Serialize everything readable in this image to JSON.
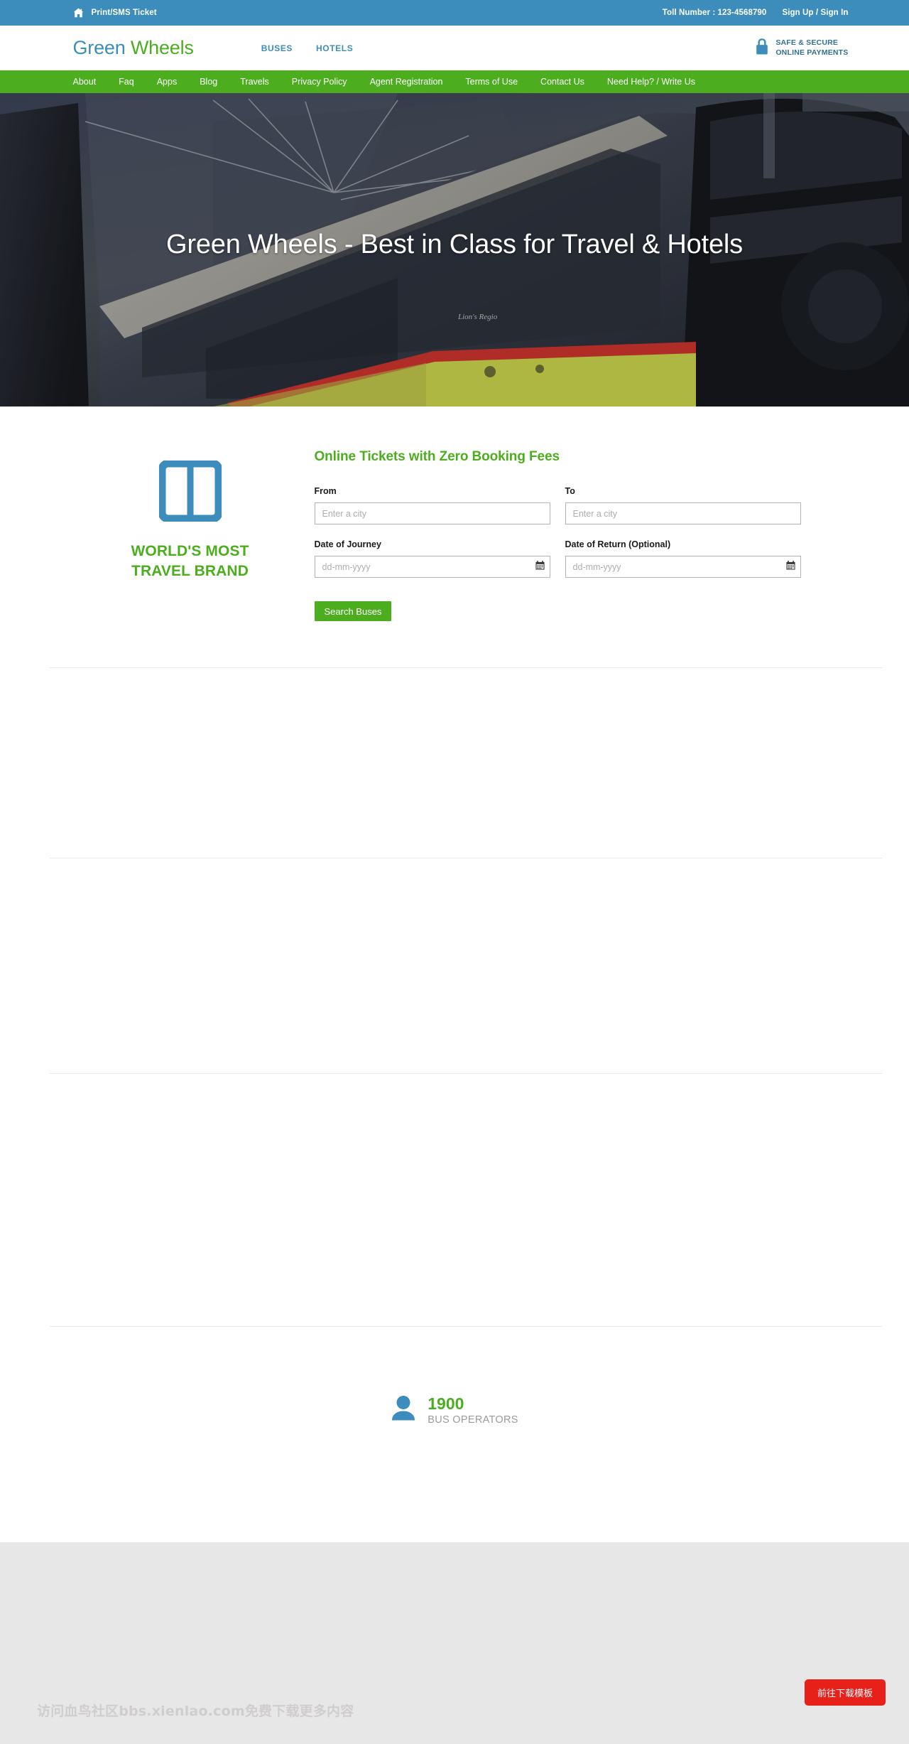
{
  "topbar": {
    "home_icon": "home-icon",
    "print_ticket": "Print/SMS Ticket",
    "toll": "Toll Number : 123-4568790",
    "auth": "Sign Up / Sign In"
  },
  "header": {
    "brand_part1": "Green ",
    "brand_part2": "Wheels",
    "links": [
      {
        "label": "BUSES"
      },
      {
        "label": "HOTELS"
      }
    ],
    "secure_icon": "lock-icon",
    "secure_line1": "SAFE & SECURE",
    "secure_line2": "ONLINE PAYMENTS"
  },
  "nav": {
    "items": [
      {
        "label": "About"
      },
      {
        "label": "Faq"
      },
      {
        "label": "Apps"
      },
      {
        "label": "Blog"
      },
      {
        "label": "Travels"
      },
      {
        "label": "Privacy Policy"
      },
      {
        "label": "Agent Registration"
      },
      {
        "label": "Terms of Use"
      },
      {
        "label": "Contact Us"
      },
      {
        "label": "Need Help?  / Write Us"
      }
    ]
  },
  "hero": {
    "title": "Green Wheels - Best in Class for Travel & Hotels",
    "image_alt": "coach-bus-photo"
  },
  "promo": {
    "icon": "book-open-icon",
    "tagline_line1": "WORLD'S MOST",
    "tagline_line2": "TRAVEL BRAND"
  },
  "search_form": {
    "title": "Online Tickets with Zero Booking Fees",
    "fields": [
      {
        "label": "From",
        "placeholder": "Enter a city",
        "value": ""
      },
      {
        "label": "To",
        "placeholder": "Enter a city",
        "value": ""
      },
      {
        "label": "Date of Journey",
        "placeholder": "dd-mm-yyyy",
        "value": ""
      },
      {
        "label": "Date of Return (Optional)",
        "placeholder": "dd-mm-yyyy",
        "value": ""
      }
    ],
    "submit_label": "Search Buses"
  },
  "stats": {
    "icon": "user-icon",
    "number": "1900",
    "label": "BUS OPERATORS"
  },
  "footer": {
    "watermark": "访问血鸟社区bbs.xienlao.com免费下载更多内容",
    "download_label": "前往下载模板"
  },
  "colors": {
    "topbar_blue": "#3c8dbc",
    "nav_green": "#4cae1e",
    "brand_blue": "#3c8dbc",
    "brand_green": "#4cae1e",
    "download_red": "#e8201a",
    "footer_gray": "#e7e7e7"
  }
}
